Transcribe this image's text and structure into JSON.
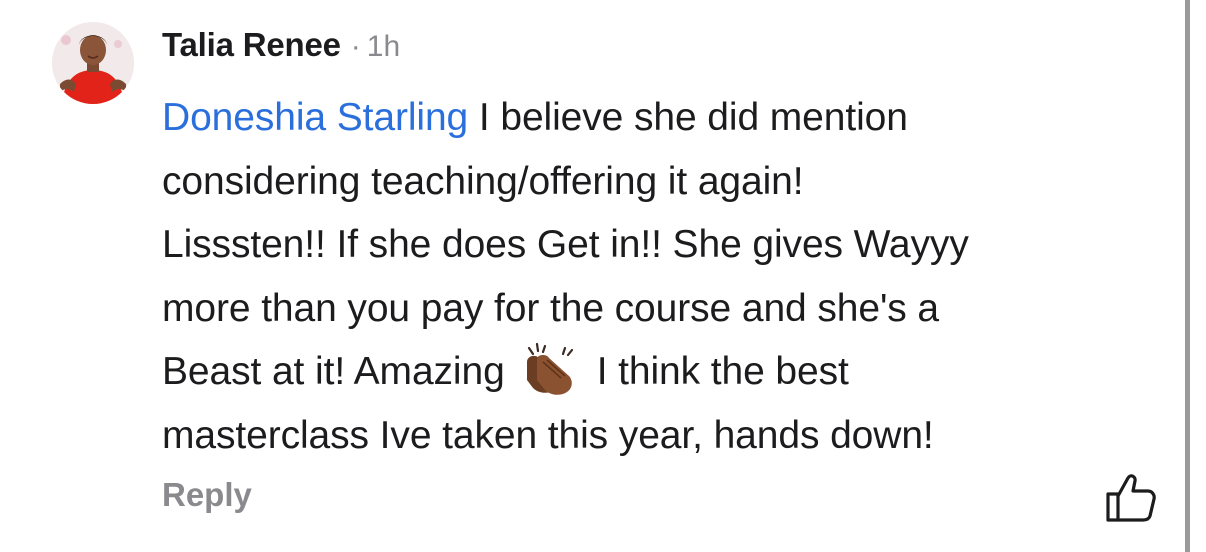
{
  "comment": {
    "author": "Talia Renee",
    "separator": "·",
    "time": "1h",
    "mention": "Doneshia Starling",
    "lines": [
      " I believe she did mention",
      "considering teaching/offering it again!",
      "Lisssten!! If she does Get in!! She gives Wayyy",
      "more than you pay for the course and she's a",
      "Beast at it! Amazing",
      "I think the best",
      "masterclass Ive taken this year, hands down!"
    ],
    "emoji": "clapping-hands-medium-dark-skin",
    "reply_label": "Reply"
  },
  "colors": {
    "mention": "#2a6fdb",
    "text": "#1c1c1e",
    "muted": "#8a8a8e"
  }
}
